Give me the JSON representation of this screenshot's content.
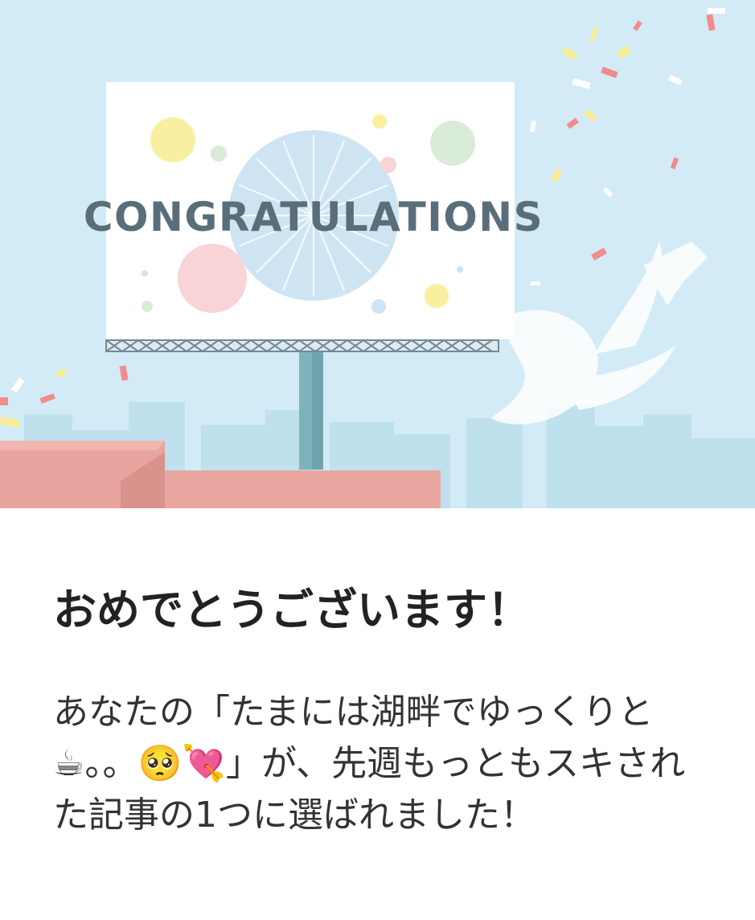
{
  "banner": {
    "billboard_text": "CONGRATULATIONS",
    "colors": {
      "sky": "#d3ebf6",
      "billboard_text": "#5a6e7a",
      "building_pink": "#e8a49e",
      "pole": "#7fb3bc"
    }
  },
  "content": {
    "title": "おめでとうございます！",
    "message": "あなたの「たまには湖畔でゆっくりと☕。。🥺💘」が、先週もっともスキされた記事の1つに選ばれました！"
  }
}
